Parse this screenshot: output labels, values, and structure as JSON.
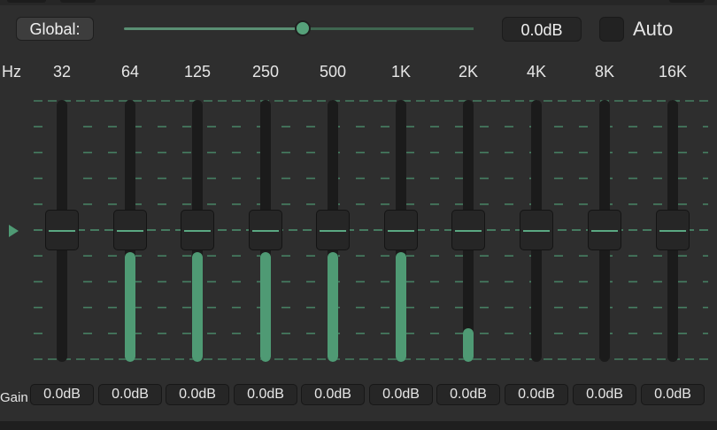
{
  "global": {
    "label": "Global:",
    "value": "0.0dB",
    "slider_fraction": 0.5,
    "auto_label": "Auto",
    "auto_checked": false
  },
  "axis": {
    "hz_label": "Hz",
    "gain_label": "Gain"
  },
  "bands": [
    {
      "freq": "32",
      "value": "0.0dB",
      "fill_fraction": 0.0
    },
    {
      "freq": "64",
      "value": "0.0dB",
      "fill_fraction": 0.42
    },
    {
      "freq": "125",
      "value": "0.0dB",
      "fill_fraction": 0.42
    },
    {
      "freq": "250",
      "value": "0.0dB",
      "fill_fraction": 0.42
    },
    {
      "freq": "500",
      "value": "0.0dB",
      "fill_fraction": 0.42
    },
    {
      "freq": "1K",
      "value": "0.0dB",
      "fill_fraction": 0.42
    },
    {
      "freq": "2K",
      "value": "0.0dB",
      "fill_fraction": 0.13
    },
    {
      "freq": "4K",
      "value": "0.0dB",
      "fill_fraction": 0.0
    },
    {
      "freq": "8K",
      "value": "0.0dB",
      "fill_fraction": 0.0
    },
    {
      "freq": "16K",
      "value": "0.0dB",
      "fill_fraction": 0.0
    }
  ],
  "colors": {
    "accent": "#4f9a74",
    "background": "#2e2e2e",
    "track": "#1b1b1b"
  }
}
